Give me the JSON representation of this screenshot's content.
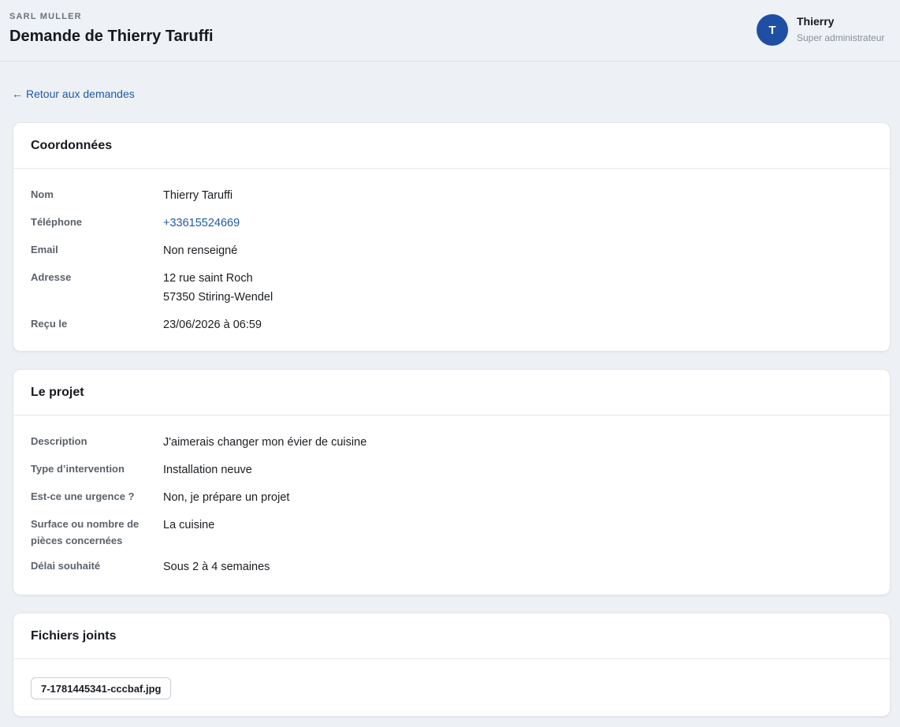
{
  "header": {
    "company": "SARL MULLER",
    "title": "Demande de Thierry Taruffi",
    "user": {
      "initial": "T",
      "name": "Thierry",
      "role": "Super administrateur",
      "avatar_color": "#1f4fa3"
    }
  },
  "back_link": {
    "arrow": "←",
    "label": "Retour aux demandes"
  },
  "contact": {
    "title": "Coordonnées",
    "rows": [
      {
        "label": "Nom",
        "value": "Thierry Taruffi"
      },
      {
        "label": "Téléphone",
        "value": "+33615524669"
      },
      {
        "label": "Email",
        "value": "Non renseigné"
      },
      {
        "label": "Adresse",
        "value_line1": "12 rue saint Roch",
        "value_line2": "57350 Stiring-Wendel"
      },
      {
        "label": "Reçu le",
        "value": "23/06/2026 à 06:59"
      }
    ]
  },
  "project": {
    "title": "Le projet",
    "rows": [
      {
        "label": "Description",
        "value": "J'aimerais changer mon évier de cuisine"
      },
      {
        "label": "Type d’intervention",
        "value": "Installation neuve"
      },
      {
        "label": "Est-ce une urgence ?",
        "value": "Non, je prépare un projet"
      },
      {
        "label_line1": "Surface ou nombre de",
        "label_line2": "pièces concernées",
        "value": "La cuisine"
      },
      {
        "label": "Délai souhaité",
        "value": "Sous 2 à 4 semaines"
      }
    ]
  },
  "files": {
    "title": "Fichiers joints",
    "items": [
      {
        "name": "7-1781445341-cccbaf.jpg"
      }
    ]
  },
  "colors": {
    "link": "#1f5aa6",
    "background": "#edf0f4"
  }
}
